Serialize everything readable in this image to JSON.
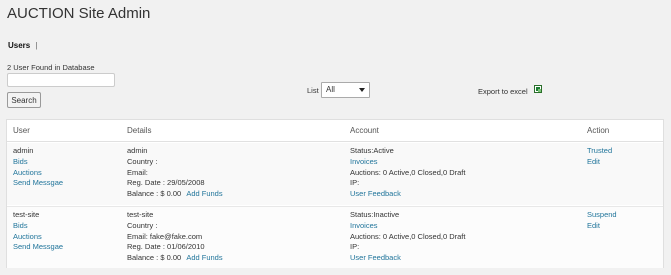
{
  "page": {
    "title": "AUCTION Site Admin",
    "subnav_current": "Users",
    "subnav_separator": "|",
    "found_text": "2 User Found in Database"
  },
  "search": {
    "value": "",
    "placeholder": "",
    "button_label": "Search"
  },
  "list": {
    "label": "List",
    "selected": "All"
  },
  "export": {
    "label": "Export to excel",
    "icon": "excel-icon"
  },
  "table": {
    "headers": [
      "User",
      "Details",
      "Account",
      "Action"
    ],
    "rows": [
      {
        "username": "admin",
        "links": [
          "Bids",
          "Auctions",
          "Send Messgae"
        ],
        "details": {
          "name": "admin",
          "country": "Country :",
          "email": "Email:",
          "reg_date": "Reg. Date : 29/05/2008",
          "balance": "Balance : $ 0.00",
          "add_funds": "Add Funds"
        },
        "account": {
          "status": "Status:Active",
          "invoices": "Invoices",
          "auctions": "Auctions: 0 Active,0 Closed,0 Draft",
          "ip": "IP:",
          "feedback": "User Feedback"
        },
        "actions": [
          "Trusted",
          "Edit"
        ]
      },
      {
        "username": "test-site",
        "links": [
          "Bids",
          "Auctions",
          "Send Messgae"
        ],
        "details": {
          "name": "test-site",
          "country": "Country :",
          "email": "Email: fake@fake.com",
          "reg_date": "Reg. Date : 01/06/2010",
          "balance": "Balance : $ 0.00",
          "add_funds": "Add Funds"
        },
        "account": {
          "status": "Status:Inactive",
          "invoices": "Invoices",
          "auctions": "Auctions: 0 Active,0 Closed,0 Draft",
          "ip": "IP:",
          "feedback": "User Feedback"
        },
        "actions": [
          "Suspend",
          "Edit"
        ]
      }
    ]
  },
  "colors": {
    "link": "#21759b",
    "background": "#f1f1f1",
    "text": "#333333"
  }
}
